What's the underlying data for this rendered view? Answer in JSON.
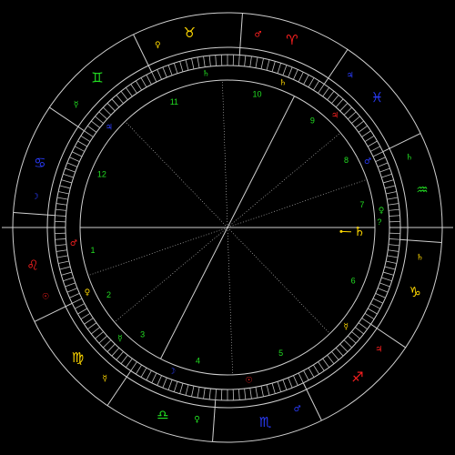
{
  "colors": {
    "background": "#000000",
    "lines": "#d0d0d0",
    "fire": "#ff2020",
    "earth": "#ffd800",
    "air": "#22dd22",
    "water": "#2a3cff",
    "houses": "#22dd22",
    "pointer": "#ffd800"
  },
  "zodiac": {
    "ascendant_deg": 124,
    "signs": [
      {
        "name": "aries",
        "symbol": "♈",
        "element": "fire",
        "ruler": "♂"
      },
      {
        "name": "taurus",
        "symbol": "♉",
        "element": "earth",
        "ruler": "♀"
      },
      {
        "name": "gemini",
        "symbol": "♊",
        "element": "air",
        "ruler": "☿"
      },
      {
        "name": "cancer",
        "symbol": "♋",
        "element": "water",
        "ruler": "☽"
      },
      {
        "name": "leo",
        "symbol": "♌",
        "element": "fire",
        "ruler": "☉"
      },
      {
        "name": "virgo",
        "symbol": "♍",
        "element": "earth",
        "ruler": "☿"
      },
      {
        "name": "libra",
        "symbol": "♎",
        "element": "air",
        "ruler": "♀"
      },
      {
        "name": "scorpio",
        "symbol": "♏",
        "element": "water",
        "ruler": "♂"
      },
      {
        "name": "sagittarius",
        "symbol": "♐",
        "element": "fire",
        "ruler": "♃"
      },
      {
        "name": "capricorn",
        "symbol": "♑",
        "element": "earth",
        "ruler": "♄"
      },
      {
        "name": "aquarius",
        "symbol": "♒",
        "element": "air",
        "ruler": "♄"
      },
      {
        "name": "pisces",
        "symbol": "♓",
        "element": "water",
        "ruler": "♃"
      }
    ]
  },
  "houses": [
    {
      "number": "1",
      "cusp_deg": 124,
      "ruler": "♂",
      "ruler_element": "fire"
    },
    {
      "number": "2",
      "cusp_deg": 143,
      "ruler": "♀",
      "ruler_element": "earth"
    },
    {
      "number": "3",
      "cusp_deg": 164,
      "ruler": "☿",
      "ruler_element": "air"
    },
    {
      "number": "4",
      "cusp_deg": 187,
      "ruler": "☽",
      "ruler_element": "water"
    },
    {
      "number": "5",
      "cusp_deg": 216,
      "ruler": "☉",
      "ruler_element": "fire"
    },
    {
      "number": "6",
      "cusp_deg": 258,
      "ruler": "☿",
      "ruler_element": "earth"
    },
    {
      "number": "7",
      "cusp_deg": 304,
      "ruler": "♀",
      "ruler_element": "air"
    },
    {
      "number": "8",
      "cusp_deg": 323,
      "ruler": "♂",
      "ruler_element": "water"
    },
    {
      "number": "9",
      "cusp_deg": 344,
      "ruler": "♃",
      "ruler_element": "fire"
    },
    {
      "number": "10",
      "cusp_deg": 7,
      "ruler": "♄",
      "ruler_element": "earth"
    },
    {
      "number": "11",
      "cusp_deg": 36,
      "ruler": "♄",
      "ruler_element": "air"
    },
    {
      "number": "12",
      "cusp_deg": 78,
      "ruler": "♃",
      "ruler_element": "water"
    }
  ],
  "planets": [
    {
      "name": "saturn",
      "symbol": "♄",
      "longitude_deg": 302,
      "element": "earth"
    }
  ],
  "extra_glyphs": [
    {
      "name": "question-mark",
      "text": "?",
      "longitude_deg": 306,
      "element": "air"
    }
  ]
}
